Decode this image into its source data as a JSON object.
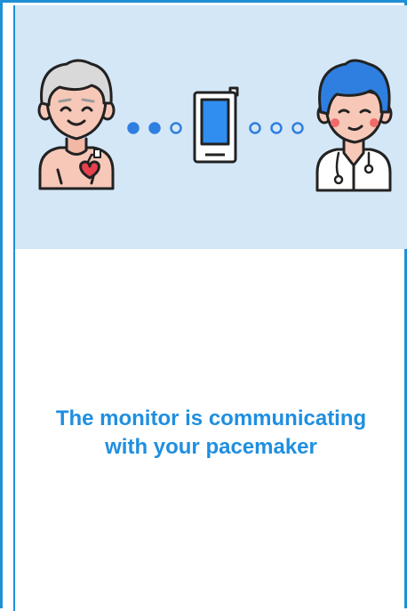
{
  "status": {
    "line1": "The monitor is communicating",
    "line2": "with your pacemaker"
  },
  "colors": {
    "accent": "#1f8fd6",
    "hero_background": "#d4e7f7",
    "message_text": "#1f8fe0",
    "monitor_screen": "#2f8ef0",
    "heart": "#e8414e"
  },
  "icons": {
    "patient": "elderly-patient-with-pacemaker-icon",
    "monitor": "home-monitor-device-icon",
    "doctor": "doctor-with-stethoscope-icon"
  },
  "progress": {
    "dots_total": 6,
    "dots_filled": 2
  }
}
